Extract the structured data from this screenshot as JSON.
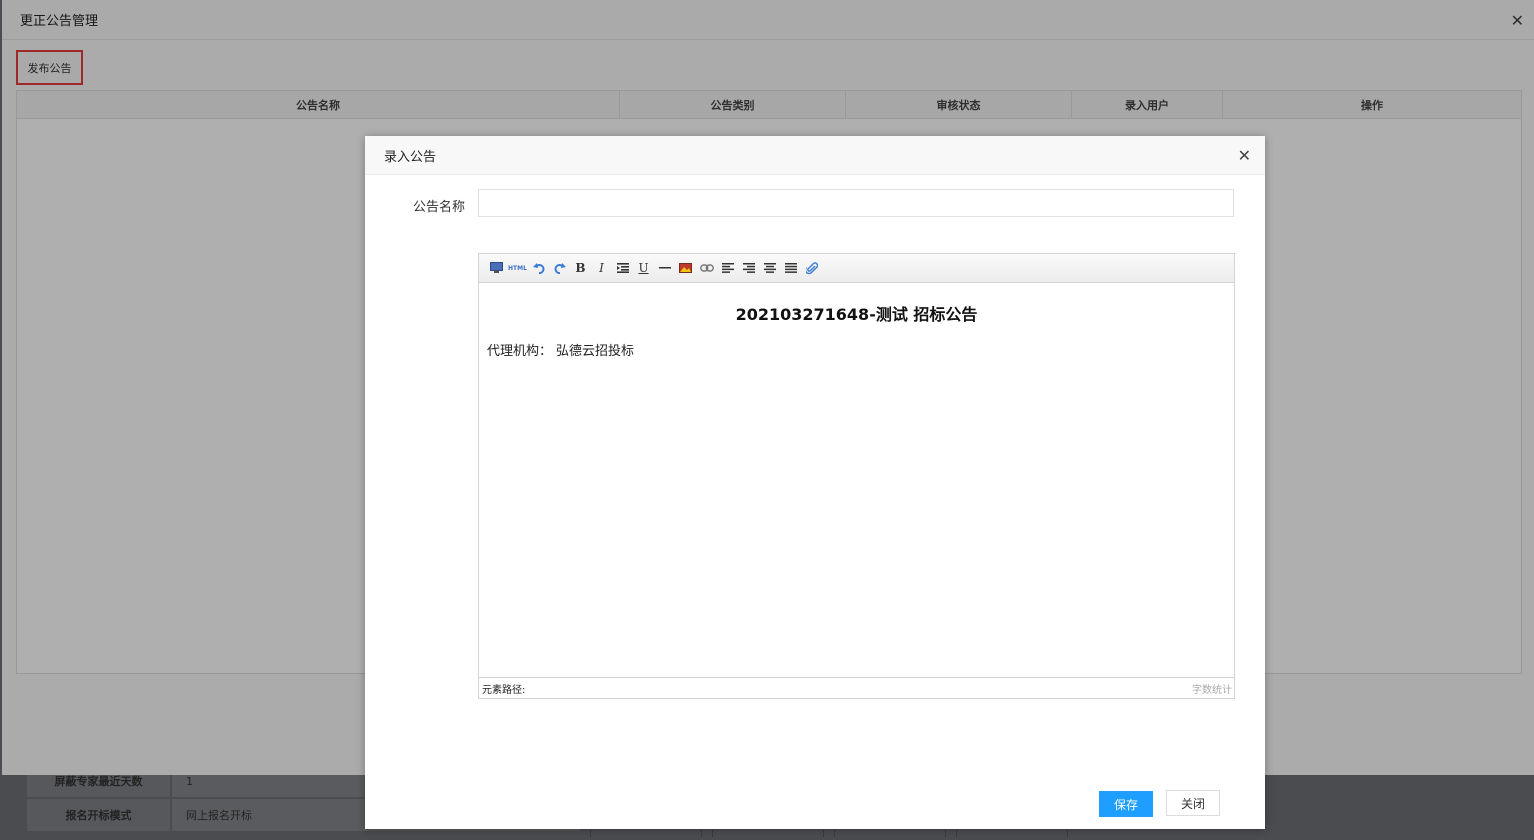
{
  "background": {
    "rows": [
      {
        "label": "屏蔽专家最近天数",
        "value": "1"
      },
      {
        "label": "报名开标模式",
        "value": "网上报名开标"
      }
    ]
  },
  "outer_modal": {
    "title": "更正公告管理",
    "publish_label": "发布公告",
    "columns": [
      "公告名称",
      "公告类别",
      "审核状态",
      "录入用户",
      "操作"
    ]
  },
  "inner_modal": {
    "title": "录入公告",
    "name_label": "公告名称",
    "name_value": "",
    "editor": {
      "toolbar": [
        {
          "name": "fullscreen-icon",
          "glyph": ""
        },
        {
          "name": "html-source-icon",
          "glyph": "HTML"
        },
        {
          "name": "undo-icon",
          "glyph": ""
        },
        {
          "name": "redo-icon",
          "glyph": ""
        },
        {
          "name": "bold-icon",
          "glyph": "B"
        },
        {
          "name": "italic-icon",
          "glyph": "I"
        },
        {
          "name": "indent-icon",
          "glyph": ""
        },
        {
          "name": "underline-icon",
          "glyph": "U"
        },
        {
          "name": "horizontal-rule-icon",
          "glyph": ""
        },
        {
          "name": "image-icon",
          "glyph": ""
        },
        {
          "name": "link-icon",
          "glyph": ""
        },
        {
          "name": "align-left-icon",
          "glyph": ""
        },
        {
          "name": "align-right-icon",
          "glyph": ""
        },
        {
          "name": "align-center-icon",
          "glyph": ""
        },
        {
          "name": "align-justify-icon",
          "glyph": ""
        },
        {
          "name": "attachment-icon",
          "glyph": ""
        }
      ],
      "content_title": "202103271648-测试 招标公告",
      "agency_label": "代理机构：",
      "agency_value": "弘德云招投标",
      "status_path": "元素路径:",
      "status_count": "字数统计"
    },
    "save_label": "保存",
    "close_label": "关闭"
  }
}
